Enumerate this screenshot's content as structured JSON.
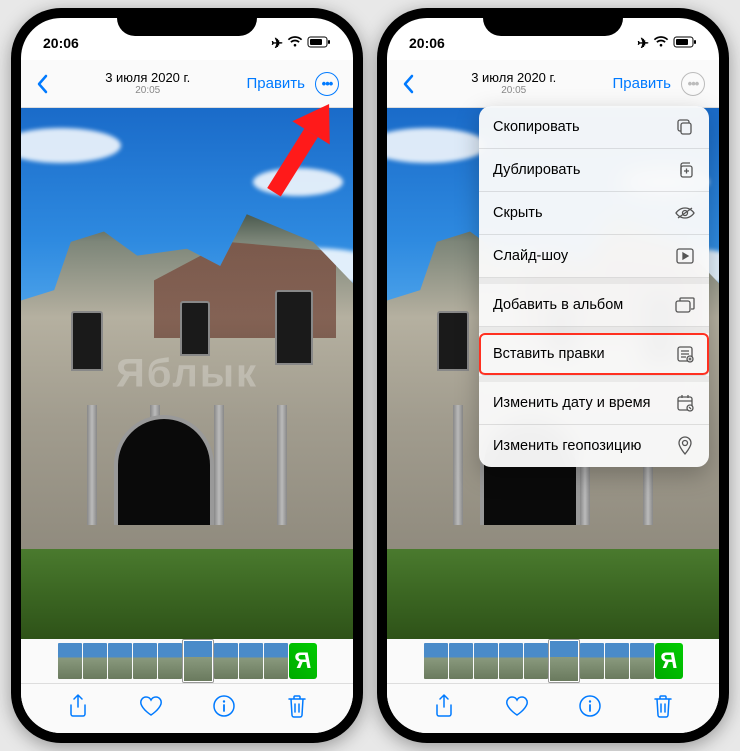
{
  "status": {
    "time": "20:06"
  },
  "nav": {
    "date": "3 июля 2020 г.",
    "time": "20:05",
    "edit": "Править"
  },
  "menu": {
    "copy": "Скопировать",
    "duplicate": "Дублировать",
    "hide": "Скрыть",
    "slideshow": "Слайд-шоу",
    "addAlbum": "Добавить в альбом",
    "pasteEdits": "Вставить правки",
    "changeDate": "Изменить дату и время",
    "changeLocation": "Изменить геопозицию"
  },
  "watermark": "Яблык"
}
